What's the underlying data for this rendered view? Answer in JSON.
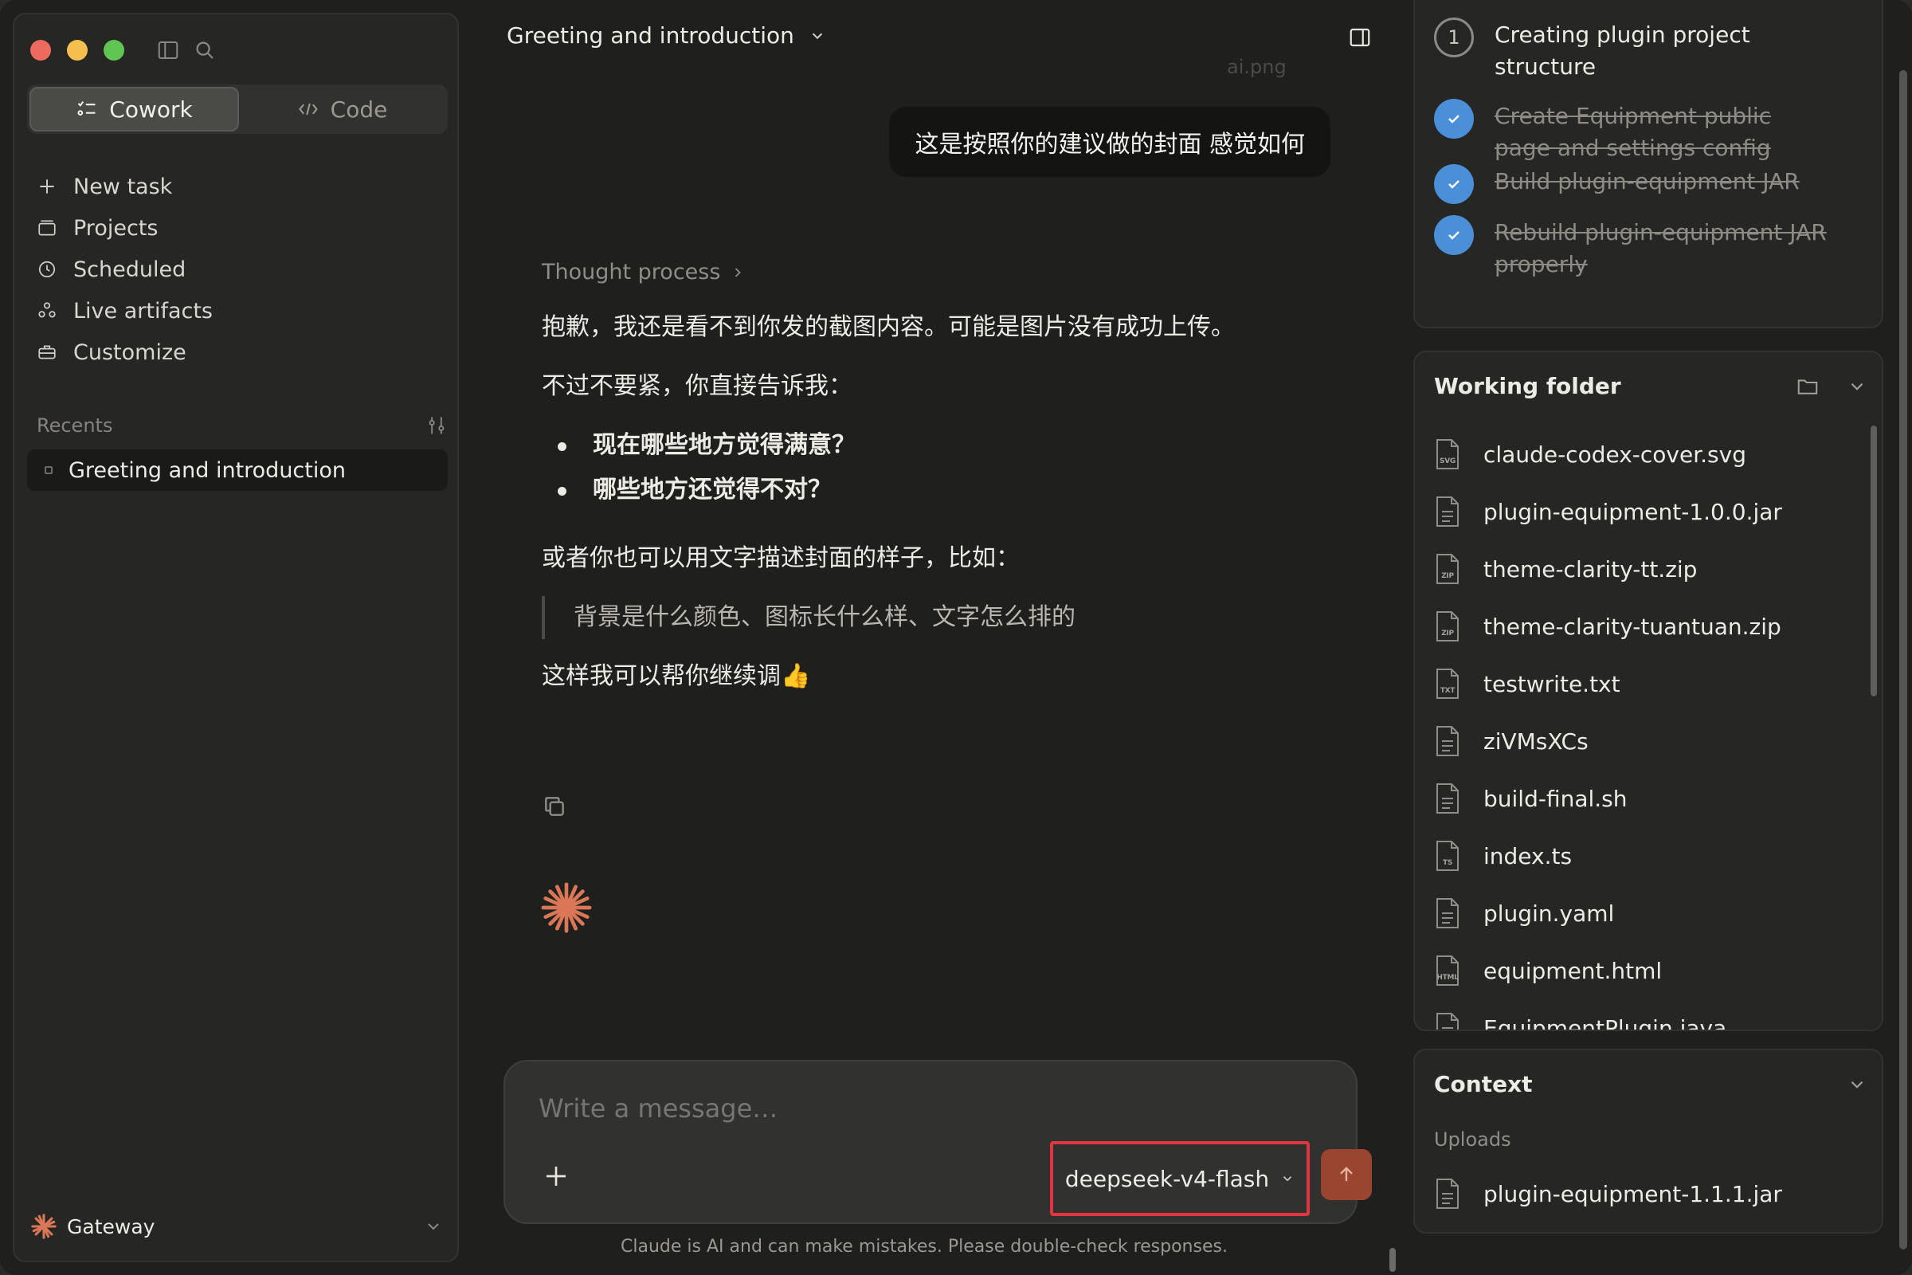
{
  "sidebar": {
    "modes": [
      {
        "label": "Cowork",
        "icon": "list-check-icon",
        "active": true
      },
      {
        "label": "Code",
        "icon": "code-icon",
        "active": false
      }
    ],
    "nav": [
      {
        "label": "New task",
        "icon": "plus-icon"
      },
      {
        "label": "Projects",
        "icon": "folder-icon"
      },
      {
        "label": "Scheduled",
        "icon": "clock-icon"
      },
      {
        "label": "Live artifacts",
        "icon": "artifacts-icon"
      },
      {
        "label": "Customize",
        "icon": "briefcase-icon"
      }
    ],
    "recents_label": "Recents",
    "recents": [
      {
        "label": "Greeting and introduction"
      }
    ],
    "footer": {
      "label": "Gateway"
    }
  },
  "chat": {
    "title": "Greeting and introduction",
    "ghost_attachment": "ai.png",
    "user_message": "这是按照你的建议做的封面 感觉如何",
    "thought_label": "Thought process",
    "reply": {
      "p1": "抱歉，我还是看不到你发的截图内容。可能是图片没有成功上传。",
      "p2": "不过不要紧，你直接告诉我：",
      "bullets": [
        "现在哪些地方觉得满意？",
        "哪些地方还觉得不对？"
      ],
      "p3": "或者你也可以用文字描述封面的样子，比如：",
      "quote": "背景是什么颜色、图标长什么样、文字怎么排的",
      "p4": "这样我可以帮你继续调👍"
    },
    "composer": {
      "placeholder": "Write a message…",
      "model": "deepseek-v4-flash"
    },
    "disclaimer": "Claude is AI and can make mistakes. Please double-check responses."
  },
  "progress": {
    "steps": [
      {
        "marker": "1",
        "label": "Creating plugin project structure",
        "done": false
      },
      {
        "marker": "",
        "label": "Create Equipment public page and settings config",
        "done": true
      },
      {
        "marker": "",
        "label": "Build plugin-equipment JAR",
        "done": true
      },
      {
        "marker": "",
        "label": "Rebuild plugin-equipment JAR properly",
        "done": true
      }
    ]
  },
  "working_folder": {
    "title": "Working folder",
    "files": [
      {
        "name": "claude-codex-cover.svg",
        "badge": "SVG"
      },
      {
        "name": "plugin-equipment-1.0.0.jar",
        "badge": ""
      },
      {
        "name": "theme-clarity-tt.zip",
        "badge": "ZIP"
      },
      {
        "name": "theme-clarity-tuantuan.zip",
        "badge": "ZIP"
      },
      {
        "name": "testwrite.txt",
        "badge": "TXT"
      },
      {
        "name": "ziVMsXCs",
        "badge": ""
      },
      {
        "name": "build-final.sh",
        "badge": ""
      },
      {
        "name": "index.ts",
        "badge": "TS"
      },
      {
        "name": "plugin.yaml",
        "badge": ""
      },
      {
        "name": "equipment.html",
        "badge": "HTML"
      },
      {
        "name": "EquipmentPlugin.java",
        "badge": ""
      }
    ]
  },
  "context": {
    "title": "Context",
    "uploads_label": "Uploads",
    "uploads": [
      {
        "name": "plugin-equipment-1.1.1.jar",
        "badge": ""
      }
    ]
  },
  "colors": {
    "accent": "#d97757",
    "check": "#4a8fd8",
    "highlight_border": "#e0363f",
    "send": "#9a4530"
  }
}
